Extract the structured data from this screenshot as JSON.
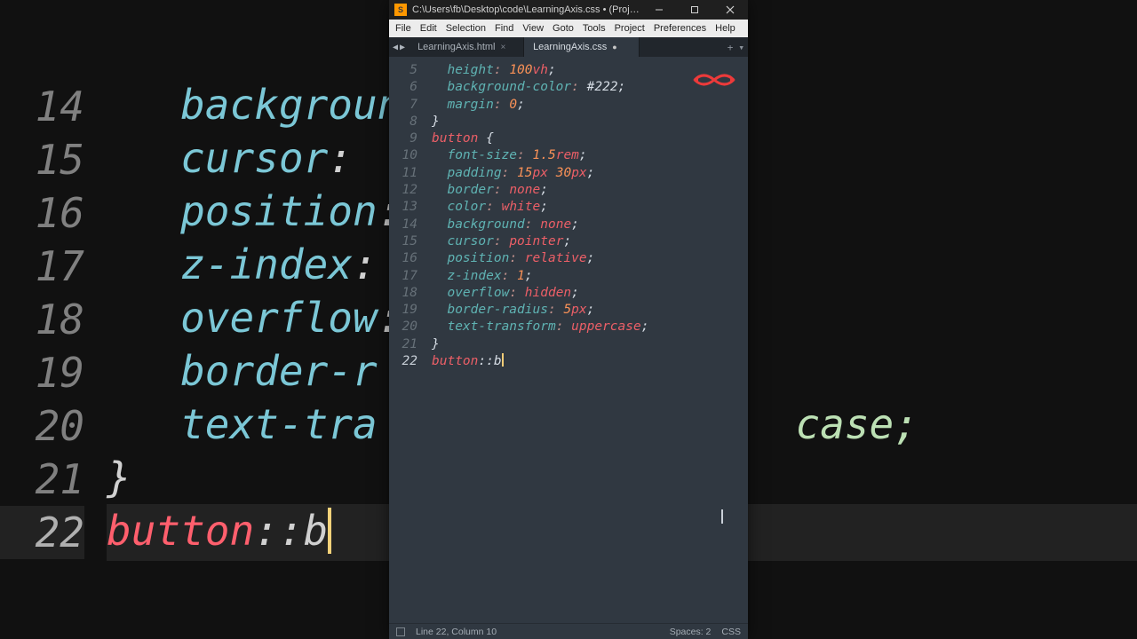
{
  "bg": {
    "lines": [
      {
        "n": "14",
        "prop": "background",
        "punc1": ":"
      },
      {
        "n": "15",
        "prop": "cursor",
        "punc1": ":"
      },
      {
        "n": "16",
        "prop": "position",
        "punc1": ":"
      },
      {
        "n": "17",
        "prop": "z-index",
        "punc1": ":"
      },
      {
        "n": "18",
        "prop": "overflow",
        "punc1": ":"
      },
      {
        "n": "19",
        "prop": "border-r",
        "punc1": ""
      },
      {
        "n": "20",
        "prop": "text-tra",
        "punc1": ""
      },
      {
        "n": "21",
        "brace": "}"
      },
      {
        "n": "22",
        "sel": "button",
        "pseudo": "::b",
        "cursor": true
      }
    ],
    "tail20": "case;"
  },
  "title": "C:\\Users\\fb\\Desktop\\code\\LearningAxis.css • (Project) - Subl...",
  "menu": [
    "File",
    "Edit",
    "Selection",
    "Find",
    "View",
    "Goto",
    "Tools",
    "Project",
    "Preferences",
    "Help"
  ],
  "tabs": [
    {
      "label": "LearningAxis.html",
      "active": false,
      "dirty": false
    },
    {
      "label": "LearningAxis.css",
      "active": true,
      "dirty": true
    }
  ],
  "code": {
    "start": 5,
    "lines": [
      {
        "prop": "height",
        "val": "100",
        "unit": "vh",
        "tail": ";"
      },
      {
        "prop": "background-color",
        "hex": "#222",
        "tail": ";"
      },
      {
        "prop": "margin",
        "val": "0",
        "tail": ";"
      },
      {
        "brace": "}"
      },
      {
        "sel": "button",
        "open": " {"
      },
      {
        "prop": "font-size",
        "val": "1.5",
        "unit": "rem",
        "tail": ";"
      },
      {
        "prop": "padding",
        "val": "15",
        "unit": "px",
        "val2": "30",
        "unit2": "px",
        "tail": ";"
      },
      {
        "prop": "border",
        "ident": "none",
        "tail": ";"
      },
      {
        "prop": "color",
        "ident": "white",
        "tail": ";"
      },
      {
        "prop": "background",
        "ident": "none",
        "tail": ";"
      },
      {
        "prop": "cursor",
        "ident": "pointer",
        "tail": ";"
      },
      {
        "prop": "position",
        "ident": "relative",
        "tail": ";"
      },
      {
        "prop": "z-index",
        "val": "1",
        "tail": ";"
      },
      {
        "prop": "overflow",
        "ident": "hidden",
        "tail": ";"
      },
      {
        "prop": "border-radius",
        "val": "5",
        "unit": "px",
        "tail": ";"
      },
      {
        "prop": "text-transform",
        "ident": "uppercase",
        "tail": ";"
      },
      {
        "brace": "}"
      },
      {
        "sel": "button",
        "pseudo": "::b",
        "cursor": true
      }
    ]
  },
  "status": {
    "pos": "Line 22, Column 10",
    "spaces": "Spaces: 2",
    "lang": "CSS"
  }
}
